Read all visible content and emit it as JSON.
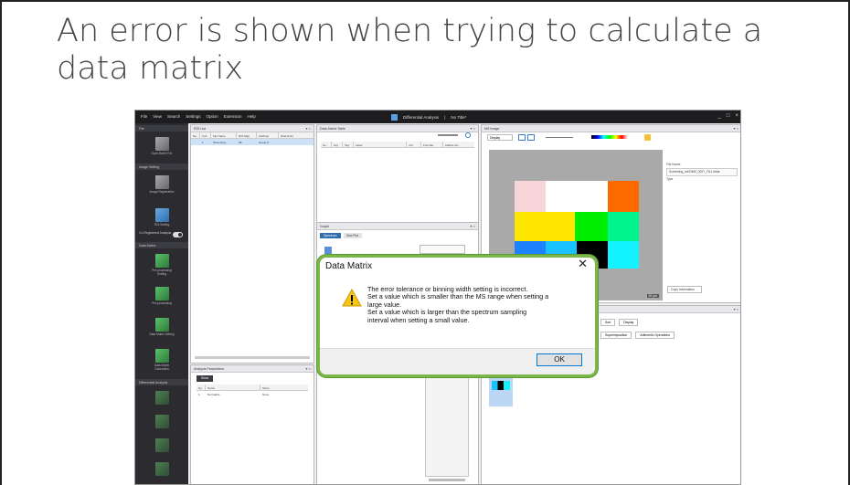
{
  "slide": {
    "title": "An error is shown when trying to calculate a data matrix"
  },
  "app": {
    "menu": [
      "File",
      "View",
      "Search",
      "Settings",
      "Option",
      "Extension",
      "Help"
    ],
    "analysis_mode": "Differential Analysis",
    "project": "No Title*",
    "window_controls": [
      "_",
      "□",
      "×"
    ],
    "ribbon": {
      "sections": [
        "File",
        "Image Setting",
        "Data Matrix",
        "Differential Analysis"
      ],
      "buttons": [
        {
          "label": "Open Batch File",
          "icon": "open-file-icon"
        },
        {
          "label": "Image Registration",
          "icon": "image-registration-icon"
        },
        {
          "label": "ROI Setting",
          "icon": "roi-setting-icon"
        },
        {
          "label": "Pre-processing Setting",
          "icon": "preprocessing-setting-icon"
        },
        {
          "label": "Pre-processing",
          "icon": "preprocessing-icon"
        },
        {
          "label": "Data Matrix Setting",
          "icon": "data-matrix-setting-icon"
        },
        {
          "label": "Data Matrix Calculation",
          "icon": "data-matrix-calculation-icon"
        }
      ],
      "toggle_label": "Co-Registered Analysis"
    },
    "roi_list": {
      "title": "ROI List",
      "columns": [
        "Na",
        "Unit",
        "File Name",
        "ROI Map",
        "Attribute",
        "Data Point"
      ],
      "rows": [
        [
          "",
          "1",
          "Screening...",
          "ML",
          "Group A",
          ""
        ]
      ]
    },
    "data_matrix_table": {
      "title": "Data Matrix Table",
      "columns": [
        "No.",
        "Grp",
        "Tag",
        "Label",
        "m/z",
        "Formula",
        "Adduct Ion"
      ]
    },
    "ms_image": {
      "title": "MS Image",
      "display_label": "Display",
      "side_labels": [
        "File Name",
        "Screening_weSIMS_0097_FA1.imda",
        "Type"
      ],
      "copy_info": "Copy Information",
      "zoom": "20 µm"
    },
    "graph": {
      "title": "Graph",
      "tabs": [
        "Spectrum",
        "Box Plot"
      ]
    },
    "analysis_parameters": {
      "title": "Analysis Parameters",
      "add_button": "Show",
      "columns": [
        "No.",
        "Name",
        "Show"
      ],
      "rows": [
        [
          "1",
          "Normalize",
          "None"
        ]
      ]
    },
    "lower_right": {
      "buttons": [
        "Sort",
        "Display",
        "Superimposition",
        "Arithmetic Operations"
      ]
    }
  },
  "dialog": {
    "title": "Data Matrix",
    "close": "✕",
    "message_lines": [
      "The error tolerance or binning width setting is incorrect.",
      "Set a value which is smaller than the MS range when setting a",
      "large value.",
      "Set a value which is larger than the spectrum sampling",
      "interval when setting a small value."
    ],
    "ok_label": "OK",
    "highlight_color": "#7ab648"
  },
  "colors": {
    "ribbon_bg": "#2b2b30",
    "titlebar_bg": "#1d1d1f",
    "selection": "#cde2f7"
  }
}
